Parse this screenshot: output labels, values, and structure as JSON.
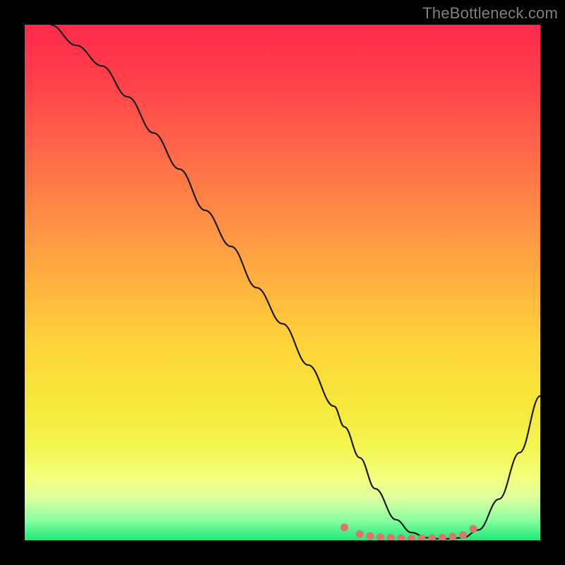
{
  "watermark": {
    "text": "TheBottleneck.com"
  },
  "chart_data": {
    "type": "line",
    "title": "",
    "xlabel": "",
    "ylabel": "",
    "xlim": [
      0,
      100
    ],
    "ylim": [
      0,
      100
    ],
    "grid": false,
    "axes": false,
    "background": "vertical-gradient red→yellow→green",
    "series": [
      {
        "name": "bottleneck-curve",
        "x": [
          5,
          10,
          15,
          20,
          25,
          30,
          35,
          40,
          45,
          50,
          55,
          60,
          62,
          65,
          68,
          72,
          75,
          78,
          80,
          82,
          85,
          88,
          92,
          96,
          100
        ],
        "y": [
          100,
          96,
          92,
          86,
          79,
          72,
          64,
          57,
          49,
          42,
          34,
          26,
          22,
          16,
          10,
          4,
          1.5,
          0.5,
          0.3,
          0.3,
          0.5,
          2,
          8,
          17,
          28
        ]
      }
    ],
    "markers": {
      "name": "highlight-dots",
      "color": "#d8766e",
      "x": [
        62,
        65,
        67,
        69,
        71,
        73,
        75,
        77,
        79,
        81,
        83,
        85,
        87
      ],
      "y": [
        2.5,
        1.2,
        0.8,
        0.6,
        0.5,
        0.4,
        0.35,
        0.35,
        0.4,
        0.5,
        0.7,
        1.0,
        2.2
      ]
    }
  }
}
